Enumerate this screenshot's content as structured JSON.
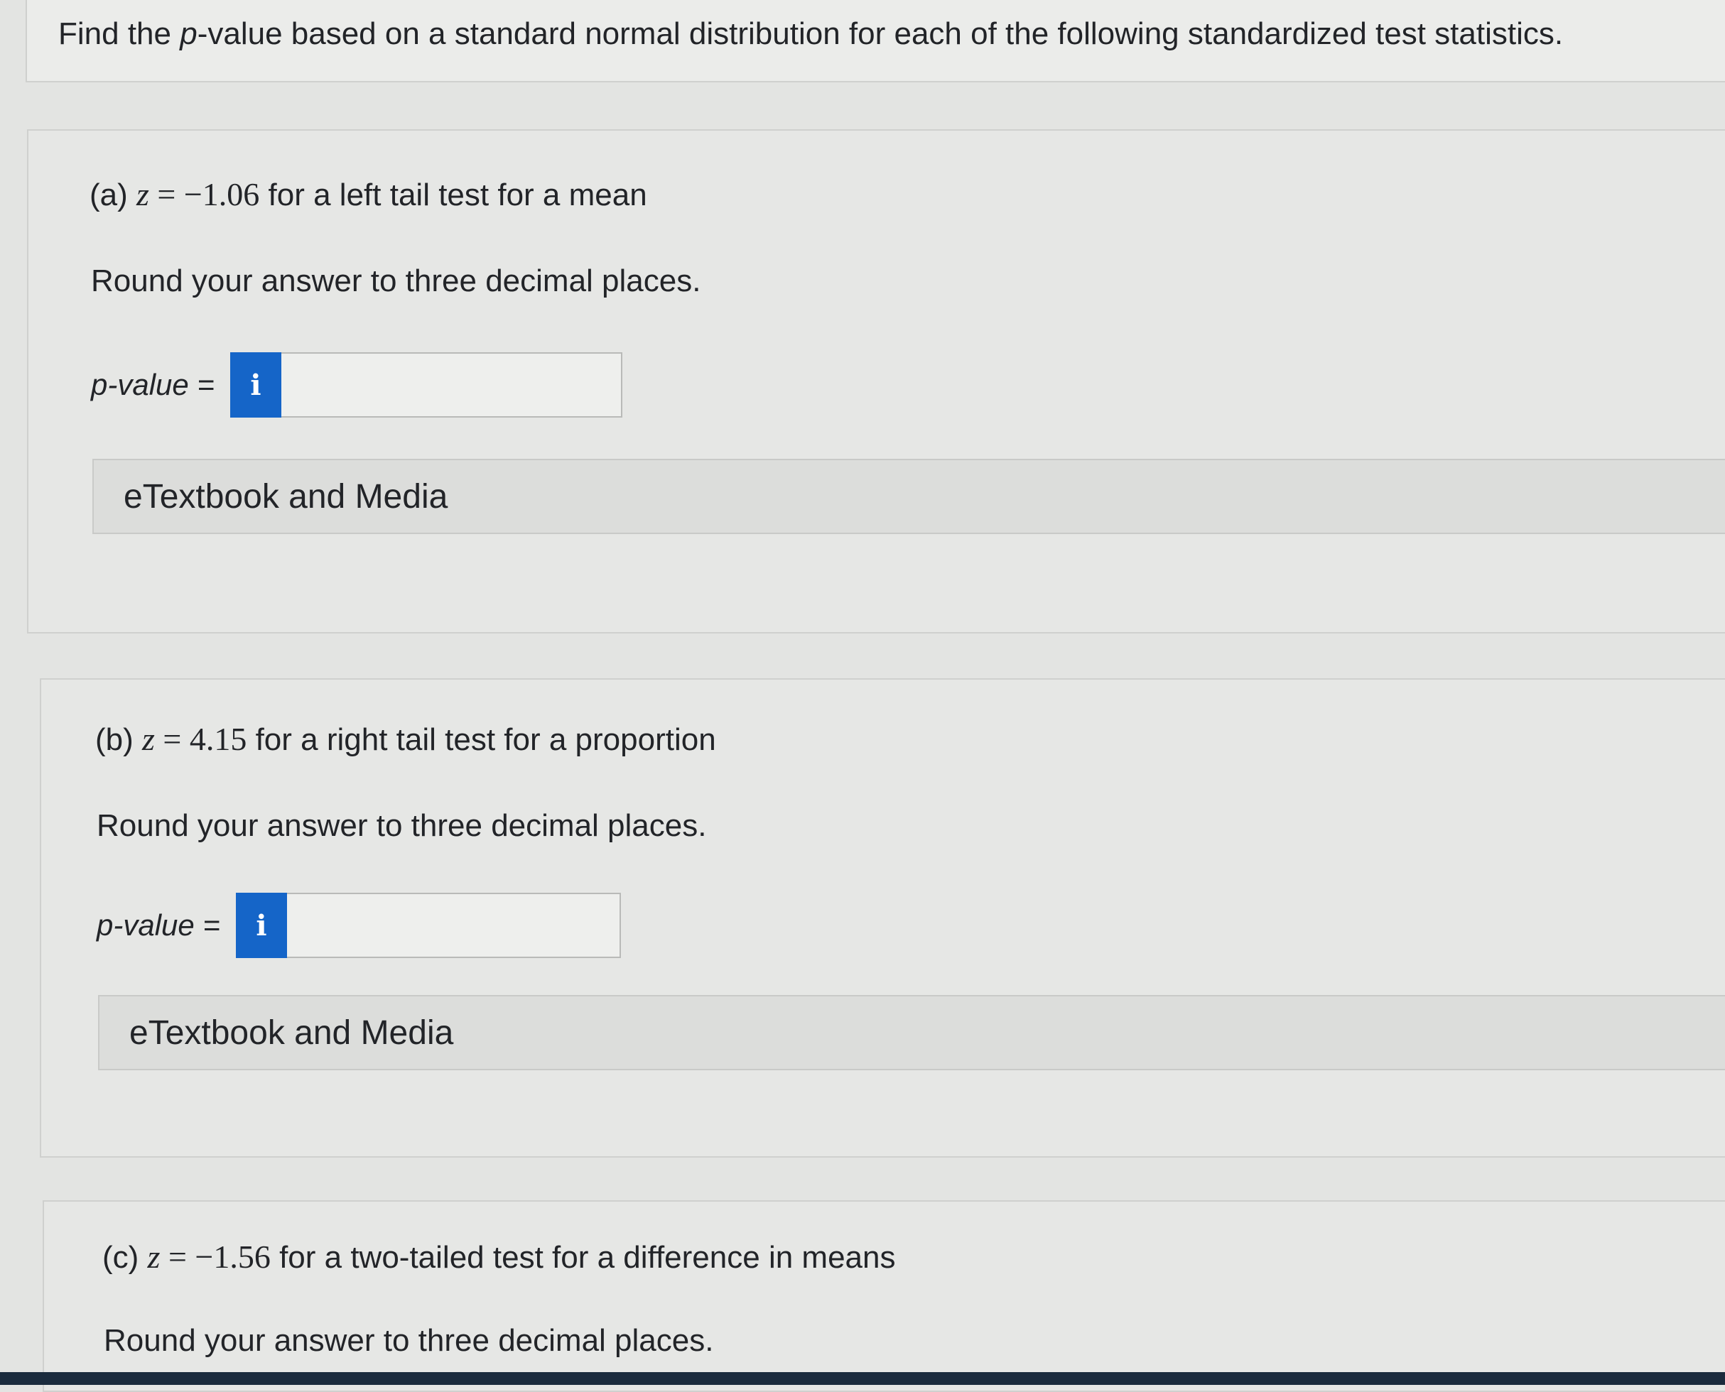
{
  "header": {
    "text_before": "Find the ",
    "text_italic": "p",
    "text_after": "-value based on a standard normal distribution for each of the following standardized test statistics."
  },
  "parts": [
    {
      "prefix": "(a) ",
      "var": "z",
      "eq": " = ",
      "value": "−1.06",
      "suffix": " for a left tail test for a mean",
      "instruction": "Round your answer to three decimal places.",
      "pvalue_label": "p-value =",
      "pvalue_value": "",
      "info_icon": "i",
      "etextbook_label": "eTextbook and Media"
    },
    {
      "prefix": "(b) ",
      "var": "z",
      "eq": " = ",
      "value": "4.15",
      "suffix": " for a right tail test for a proportion",
      "instruction": "Round your answer to three decimal places.",
      "pvalue_label": "p-value =",
      "pvalue_value": "",
      "info_icon": "i",
      "etextbook_label": "eTextbook and Media"
    },
    {
      "prefix": "(c) ",
      "var": "z",
      "eq": " = ",
      "value": "−1.56",
      "suffix": " for a two-tailed test for a difference in means",
      "instruction": "Round your answer to three decimal places."
    }
  ],
  "colors": {
    "info_button": "#1565c8",
    "background": "#e3e4e2"
  }
}
